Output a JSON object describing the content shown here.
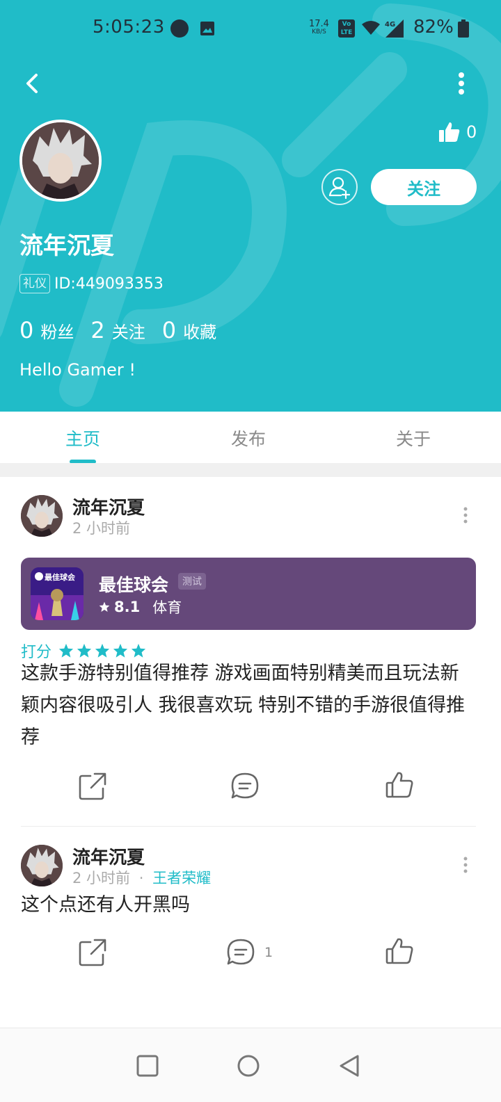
{
  "status_bar": {
    "time": "5:05:23",
    "net_speed_value": "17.4",
    "net_speed_unit": "KB/S",
    "volte_top": "Vo",
    "volte_bottom": "LTE",
    "network_type": "4G",
    "battery": "82%"
  },
  "profile": {
    "name": "流年沉夏",
    "badge": "礼仪",
    "id_text": "ID:449093353",
    "likes": "0",
    "follow_label": "关注",
    "stats": [
      {
        "num": "0",
        "label": "粉丝"
      },
      {
        "num": "2",
        "label": "关注"
      },
      {
        "num": "0",
        "label": "收藏"
      }
    ],
    "bio": "Hello Gamer !"
  },
  "tabs": [
    {
      "label": "主页",
      "active": true
    },
    {
      "label": "发布",
      "active": false
    },
    {
      "label": "关于",
      "active": false
    }
  ],
  "posts": [
    {
      "author": "流年沉夏",
      "time": "2 小时前",
      "game": {
        "name": "最佳球会",
        "tag": "测试",
        "icon_text": "最佳球会",
        "rating": "8.1",
        "genre": "体育"
      },
      "rate_label": "打分",
      "stars": 5,
      "text": "这款手游特别值得推荐 游戏画面特别精美而且玩法新颖内容很吸引人 我很喜欢玩 特别不错的手游很值得推荐",
      "comment_count": ""
    },
    {
      "author": "流年沉夏",
      "time": "2 小时前",
      "separator": "·",
      "topic": "王者荣耀",
      "text": "这个点还有人开黑吗",
      "comment_count": "1"
    }
  ],
  "colors": {
    "accent": "#20bcc8",
    "card": "#65487a",
    "text": "#222222",
    "muted": "#aaaaaa"
  },
  "icons": [
    "back-icon",
    "more-vertical-icon",
    "thumbs-up-icon",
    "add-friend-icon",
    "star-icon",
    "share-icon",
    "comment-icon",
    "like-icon",
    "nav-recents-icon",
    "nav-home-icon",
    "nav-back-icon"
  ]
}
